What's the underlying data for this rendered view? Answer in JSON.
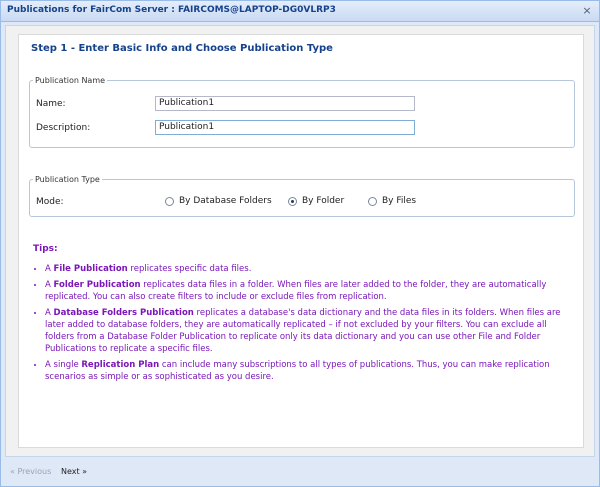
{
  "window": {
    "title": "Publications for FairCom Server : FAIRCOMS@LAPTOP-DG0VLRP3",
    "close_label": "×"
  },
  "step": {
    "title": "Step 1 - Enter Basic Info and Choose Publication Type"
  },
  "publication_name": {
    "legend": "Publication Name",
    "name_label": "Name:",
    "name_value": "Publication1",
    "description_label": "Description:",
    "description_value": "Publication1"
  },
  "publication_type": {
    "legend": "Publication Type",
    "mode_label": "Mode:",
    "options": [
      {
        "label": "By Database Folders",
        "selected": false
      },
      {
        "label": "By Folder",
        "selected": true
      },
      {
        "label": "By Files",
        "selected": false
      }
    ]
  },
  "tips": {
    "heading": "Tips:",
    "items": [
      {
        "prefix": "A ",
        "bold": "File Publication",
        "text": " replicates specific data files."
      },
      {
        "prefix": "A ",
        "bold": "Folder Publication",
        "text": " replicates data files in a folder. When files are later added to the folder, they are automatically replicated. You can also create filters to include or exclude files from replication."
      },
      {
        "prefix": "A ",
        "bold": "Database Folders Publication",
        "text": " replicates a database's data dictionary and the data files in its folders. When files are later added to database folders, they are automatically replicated – if not excluded by your filters. You can exclude all folders from a Database Folder Publication to replicate only its data dictionary and you can use other File and Folder Publications to replicate a specific files."
      },
      {
        "prefix": "A single ",
        "bold": "Replication Plan",
        "text": " can include many subscriptions to all types of publications. Thus, you can make replication scenarios as simple or as sophisticated as you desire."
      }
    ]
  },
  "footer": {
    "previous_label": "« Previous",
    "next_label": "Next »"
  }
}
